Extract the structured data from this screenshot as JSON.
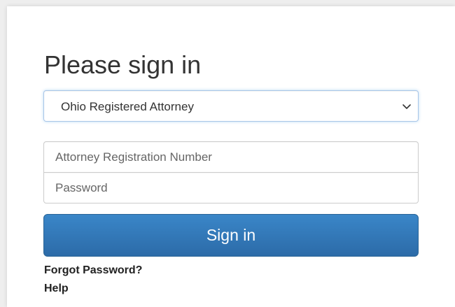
{
  "login": {
    "heading": "Please sign in",
    "user_type_select": {
      "selected": "Ohio Registered Attorney",
      "icon": "chevron-down-icon"
    },
    "registration_number": {
      "placeholder": "Attorney Registration Number",
      "value": ""
    },
    "password": {
      "placeholder": "Password",
      "value": ""
    },
    "sign_in_label": "Sign in",
    "forgot_password_label": "Forgot Password?",
    "help_label": "Help"
  },
  "colors": {
    "button_primary": "#337ab7",
    "focus_border": "#66afe9",
    "text": "#333333"
  }
}
